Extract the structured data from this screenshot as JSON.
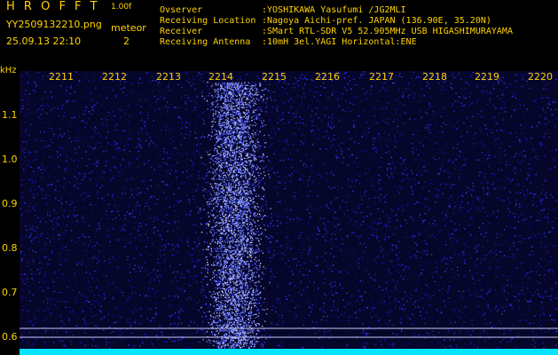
{
  "header": {
    "app_title": "H R O F F T",
    "version": "1.00f",
    "filename": "YY2509132210.png",
    "datetime": "25.09.13 22:10",
    "meteor_label": "meteor",
    "meteor_count": "2"
  },
  "station": {
    "observer_key": "Ovserver",
    "observer_val": ":YOSHIKAWA Yasufumi /JG2MLI",
    "location_key": "Receiving Location",
    "location_val": ":Nagoya Aichi-pref. JAPAN (136.90E, 35.20N)",
    "receiver_key": "Receiver",
    "receiver_val": ":SMart RTL-SDR V5 52.905MHz USB HIGASHIMURAYAMA",
    "antenna_key": "Receiving Antenna",
    "antenna_val": ":10mH 3el.YAGI Horizontal:ENE"
  },
  "axis": {
    "unit": "kHz",
    "x_labels": [
      "2211",
      "2212",
      "2213",
      "2214",
      "2215",
      "2216",
      "2217",
      "2218",
      "2219",
      "2220"
    ],
    "y_labels": [
      "1.1",
      "1.0",
      "0.9",
      "0.8",
      "0.7",
      "0.6"
    ]
  },
  "colors": {
    "label": "#ffd400",
    "background": "#000000",
    "noise": "#1a1aa8",
    "signal_band": "#6c7cff",
    "baseline": "#00e5ff"
  }
}
